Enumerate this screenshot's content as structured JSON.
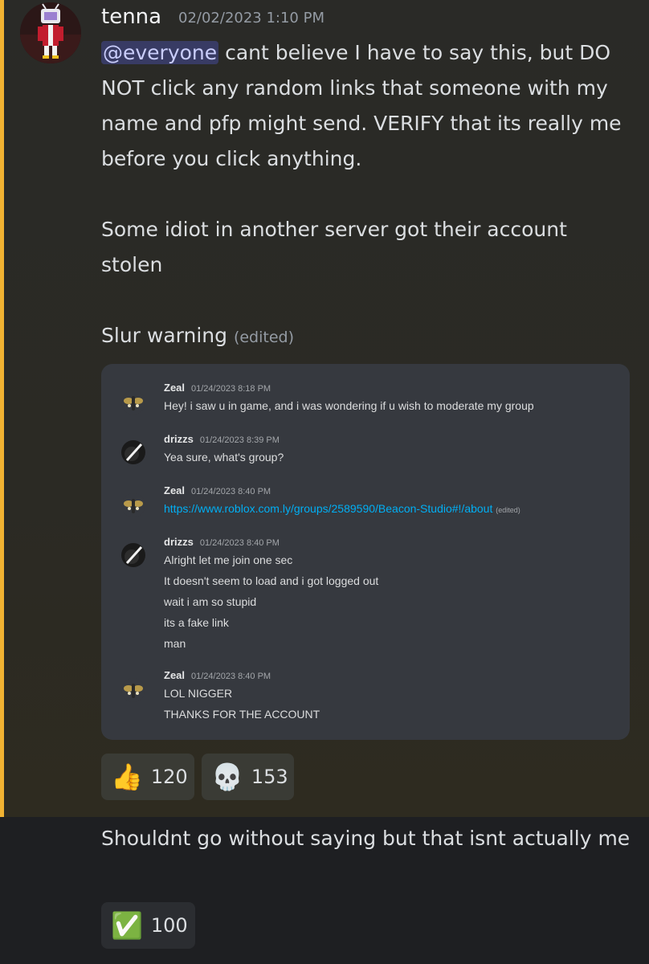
{
  "message": {
    "author": "tenna",
    "timestamp": "02/02/2023 1:10 PM",
    "mention": "@everyone",
    "line1_rest": " cant believe I have to say this, but DO NOT click any random links that someone with my name and pfp might send. VERIFY that its really me before you click anything.",
    "para2": "Some idiot in another server got their account stolen",
    "para3": "Slur warning",
    "edited_label": "(edited)"
  },
  "embed": {
    "messages": [
      {
        "author": "Zeal",
        "time": "01/24/2023 8:18 PM",
        "lines": [
          "Hey! i saw u in game, and i was wondering if u wish to moderate my group"
        ]
      },
      {
        "author": "drizzs",
        "time": "01/24/2023 8:39 PM",
        "lines": [
          "Yea sure, what's group?"
        ]
      },
      {
        "author": "Zeal",
        "time": "01/24/2023 8:40 PM",
        "link": "https://www.roblox.com.ly/groups/2589590/Beacon-Studio#!/about",
        "link_edited": "(edited)"
      },
      {
        "author": "drizzs",
        "time": "01/24/2023 8:40 PM",
        "lines": [
          "Alright let me join one sec",
          "It doesn't seem to load and i got logged out",
          "wait i am so stupid",
          "its a fake link",
          "man"
        ]
      },
      {
        "author": "Zeal",
        "time": "01/24/2023 8:40 PM",
        "lines": [
          "LOL NIGGER",
          "THANKS FOR THE ACCOUNT"
        ]
      }
    ]
  },
  "reactions": [
    {
      "emoji": "👍",
      "icon": "thumbs-up-icon",
      "count": "120"
    },
    {
      "emoji": "💀",
      "icon": "skull-icon",
      "count": "153"
    }
  ],
  "followup": {
    "text": "Shouldnt go without saying but that isnt actually me",
    "reaction": {
      "emoji": "✅",
      "icon": "check-mark-icon",
      "count": "100"
    }
  },
  "colors": {
    "highlight_bar": "#f0b232",
    "mention_bg": "#5865f2",
    "link": "#00aff4"
  }
}
